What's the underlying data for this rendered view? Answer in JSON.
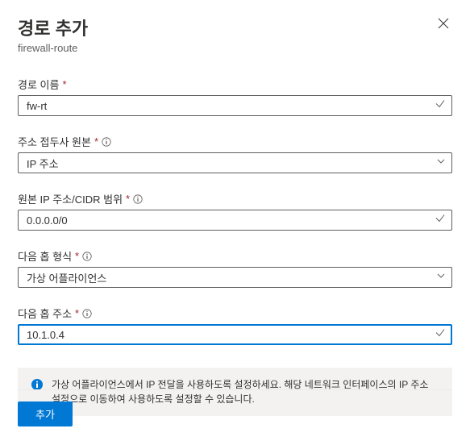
{
  "header": {
    "title": "경로 추가",
    "subtitle": "firewall-route"
  },
  "fields": {
    "route_name": {
      "label": "경로 이름",
      "value": "fw-rt"
    },
    "addr_prefix_source": {
      "label": "주소 접두사 원본",
      "value": "IP 주소"
    },
    "source_cidr": {
      "label": "원본 IP 주소/CIDR 범위",
      "value": "0.0.0.0/0"
    },
    "next_hop_type": {
      "label": "다음 홉 형식",
      "value": "가상 어플라이언스"
    },
    "next_hop_addr": {
      "label": "다음 홉 주소",
      "value": "10.1.0.4"
    }
  },
  "info_message": "가상 어플라이언스에서 IP 전달을 사용하도록 설정하세요. 해당 네트워크 인터페이스의 IP 주소 설정으로 이동하여 사용하도록 설정할 수 있습니다.",
  "buttons": {
    "add": "추가"
  }
}
